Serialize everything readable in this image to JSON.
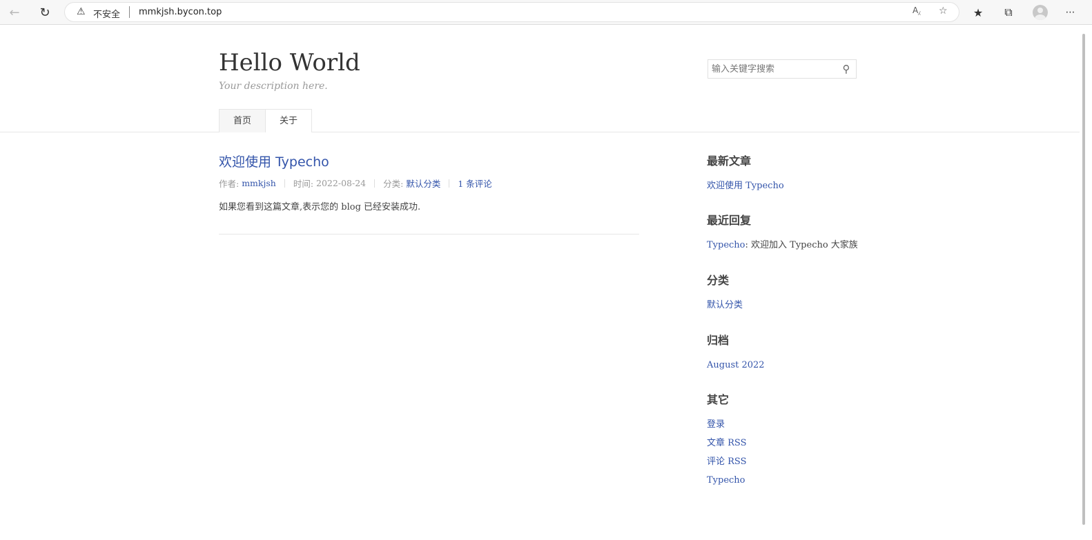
{
  "browser": {
    "security_label": "不安全",
    "url": "mmkjsh.bycon.top"
  },
  "site": {
    "title": "Hello World",
    "description": "Your description here.",
    "search_placeholder": "输入关键字搜索"
  },
  "nav": {
    "items": [
      {
        "label": "首页",
        "current": true
      },
      {
        "label": "关于",
        "current": false
      }
    ]
  },
  "post": {
    "title": "欢迎使用 Typecho",
    "author_label": "作者:",
    "author": "mmkjsh",
    "time_label": "时间:",
    "time": "2022-08-24",
    "category_label": "分类:",
    "category": "默认分类",
    "comments": "1 条评论",
    "excerpt": "如果您看到这篇文章,表示您的 blog 已经安装成功."
  },
  "sidebar": {
    "recent_posts": {
      "heading": "最新文章",
      "items": [
        "欢迎使用 Typecho"
      ]
    },
    "recent_comments": {
      "heading": "最近回复",
      "author": "Typecho",
      "text": ": 欢迎加入 Typecho 大家族"
    },
    "categories": {
      "heading": "分类",
      "items": [
        "默认分类"
      ]
    },
    "archives": {
      "heading": "归档",
      "items": [
        "August 2022"
      ]
    },
    "misc": {
      "heading": "其它",
      "items": [
        "登录",
        "文章 RSS",
        "评论 RSS",
        "Typecho"
      ]
    }
  },
  "colors": {
    "link": "#3354aa",
    "text": "#444444",
    "muted": "#999999",
    "border": "#e6e6e6"
  }
}
